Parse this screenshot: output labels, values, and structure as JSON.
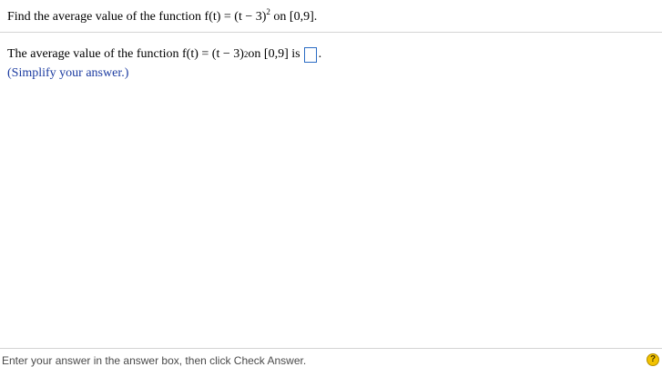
{
  "question": {
    "prefix": "Find the average value of the function f(t) = (t − 3)",
    "exponent": "2",
    "suffix": " on [0,9]."
  },
  "answer": {
    "prefix": "The average value of the function f(t) = (t − 3)",
    "exponent": "2",
    "suffix": " on [0,9] is",
    "value": "",
    "period": ".",
    "hint": "(Simplify your answer.)"
  },
  "footer": {
    "instruction": "Enter your answer in the answer box, then click Check Answer.",
    "help_icon_glyph": "?"
  },
  "colors": {
    "answer_box_border": "#2b6cc4",
    "hint_text": "#1a3aa0",
    "help_icon": "#f2c200"
  }
}
